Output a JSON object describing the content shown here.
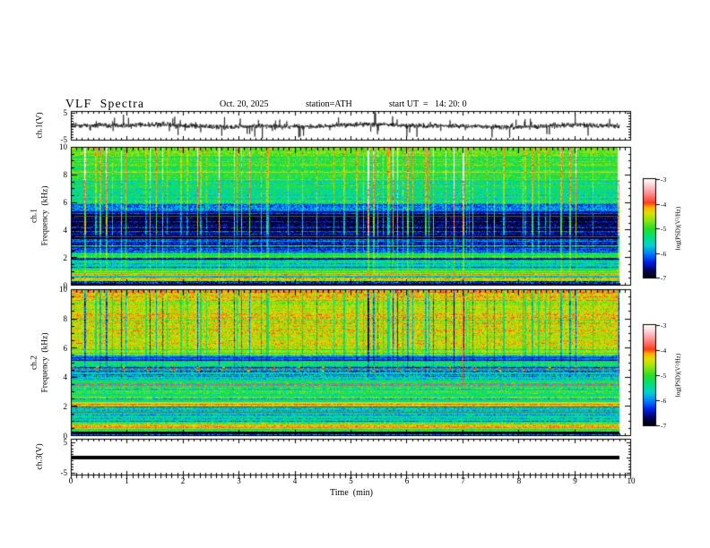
{
  "title": {
    "main": "VLF  Spectra",
    "date": "Oct. 20, 2025",
    "station": "station=ATH",
    "start_ut": "start UT  =   14: 20: 0"
  },
  "xaxis": {
    "label": "Time  (min)",
    "ticks": [
      "0",
      "1",
      "2",
      "3",
      "4",
      "5",
      "6",
      "7",
      "8",
      "9",
      "10"
    ]
  },
  "panels": {
    "ch1_voltage": {
      "ylabel": "ch.1(V)",
      "yticks": [
        "5",
        "-5"
      ]
    },
    "ch1_spectrogram": {
      "channel": "ch.1",
      "ylabel": "Frequency  (kHz)",
      "yticks": [
        "10",
        "8",
        "6",
        "4",
        "2",
        "0"
      ]
    },
    "ch2_spectrogram": {
      "channel": "ch.2",
      "ylabel": "Frequency  (kHz)",
      "yticks": [
        "10",
        "8",
        "6",
        "4",
        "2",
        "0"
      ]
    },
    "ch3_voltage": {
      "ylabel": "ch.3(V)",
      "yticks": [
        "5",
        "-5"
      ]
    }
  },
  "colorbars": [
    {
      "label": "log(PSD)(V²/Hz)",
      "ticks": [
        "-3",
        "-4",
        "-5",
        "-6",
        "-7"
      ]
    },
    {
      "label": "log(PSD)(V²/Hz)",
      "ticks": [
        "-3",
        "-4",
        "-5",
        "-6",
        "-7"
      ]
    }
  ],
  "chart_data": {
    "type": "multi-panel: line waveform + 2 spectrograms (heatmap) + line",
    "title": "VLF Spectra",
    "date": "Oct. 20, 2025",
    "station": "ATH",
    "start_ut": "14:20:0",
    "x": {
      "label": "Time (min)",
      "range": [
        0,
        10
      ],
      "data_extent": [
        0,
        9.8
      ],
      "major_tick": 1,
      "minor_tick": 0.1
    },
    "colorbar": {
      "label": "log(PSD)(V²/Hz)",
      "range": [
        -7,
        -3
      ],
      "ticks": [
        -3,
        -4,
        -5,
        -6,
        -7
      ],
      "orientation": "vertical",
      "position": "right"
    },
    "colormap_stops": [
      [
        0.0,
        0,
        0,
        0
      ],
      [
        0.07,
        5,
        0,
        80
      ],
      [
        0.16,
        0,
        30,
        230
      ],
      [
        0.25,
        0,
        130,
        255
      ],
      [
        0.33,
        0,
        210,
        210
      ],
      [
        0.42,
        0,
        225,
        120
      ],
      [
        0.5,
        40,
        220,
        40
      ],
      [
        0.58,
        140,
        230,
        20
      ],
      [
        0.66,
        225,
        225,
        0
      ],
      [
        0.72,
        255,
        170,
        0
      ],
      [
        0.76,
        255,
        60,
        25
      ],
      [
        0.83,
        255,
        120,
        115
      ],
      [
        0.91,
        255,
        185,
        190
      ],
      [
        1.0,
        255,
        255,
        255
      ]
    ],
    "panels": [
      {
        "id": "ch1_waveform",
        "kind": "line",
        "ylabel": "ch.1(V)",
        "yrange_v": [
          -5,
          5
        ],
        "line_color": "#000000",
        "character": "continuous broadband noise around 0 V (~±1 V) with frequent impulsive sferic spikes reaching ±5 V"
      },
      {
        "id": "ch1_spectrogram",
        "kind": "spectrogram",
        "channel": "ch.1",
        "freq_range_khz": [
          0,
          10
        ],
        "psd_log_range": [
          -7,
          -3
        ],
        "bands": [
          [
            9.3,
            10.01,
            -4.55,
            0.06,
            0.18,
            0.5,
            "hot"
          ],
          [
            7.6,
            9.3,
            -4.75,
            0.06,
            0.18,
            0.46,
            "hot"
          ],
          [
            6.0,
            7.6,
            -5.0,
            0.07,
            0.22,
            0.52,
            ""
          ],
          [
            5.45,
            6.0,
            -5.6,
            0.08,
            0.22,
            0.58,
            ""
          ],
          [
            5.15,
            5.45,
            -6.2,
            0.08,
            0.15,
            0.35,
            ""
          ],
          [
            3.65,
            5.15,
            -6.25,
            0.1,
            0.22,
            0.8,
            ""
          ],
          [
            3.35,
            3.65,
            -6.65,
            0.1,
            0.15,
            0.3,
            ""
          ],
          [
            2.3,
            3.35,
            -5.95,
            0.14,
            0.2,
            0.35,
            ""
          ],
          [
            2.0,
            2.3,
            -4.85,
            0.08,
            0.15,
            0.18,
            ""
          ],
          [
            1.15,
            2.0,
            -5.65,
            0.14,
            0.22,
            0.2,
            ""
          ],
          [
            0.8,
            1.15,
            -4.5,
            0.16,
            0.15,
            0.1,
            ""
          ],
          [
            0.35,
            0.8,
            -5.0,
            0.2,
            0.22,
            0.1,
            ""
          ],
          [
            0.0,
            0.35,
            -6.5,
            0.22,
            0.28,
            0.06,
            ""
          ]
        ],
        "gray_harmonic_lines_khz": [
          5.05,
          3.52
        ],
        "streaks": "bright vertical sferic streaks, orange/red bursts above 7.5 kHz, dark blue background 3.6-5.2 kHz"
      },
      {
        "id": "ch2_spectrogram",
        "kind": "spectrogram",
        "channel": "ch.2",
        "freq_range_khz": [
          0,
          10
        ],
        "psd_log_range": [
          -7,
          -3
        ],
        "bands": [
          [
            9.4,
            10.01,
            -4.5,
            0.06,
            0.2,
            -0.52,
            "specks"
          ],
          [
            6.0,
            9.4,
            -4.8,
            0.06,
            0.2,
            -0.58,
            ""
          ],
          [
            5.5,
            6.0,
            -5.15,
            0.08,
            0.2,
            -0.4,
            ""
          ],
          [
            5.15,
            5.5,
            -6.35,
            0.08,
            0.15,
            -0.15,
            ""
          ],
          [
            4.75,
            5.15,
            -5.3,
            0.1,
            0.22,
            -0.2,
            ""
          ],
          [
            4.4,
            4.75,
            -6.0,
            0.12,
            0.25,
            -0.1,
            "dash2"
          ],
          [
            3.95,
            4.4,
            -5.75,
            0.1,
            0.25,
            -0.1,
            ""
          ],
          [
            3.6,
            3.95,
            -5.35,
            0.1,
            0.22,
            0,
            ""
          ],
          [
            3.42,
            3.6,
            -5.2,
            0.08,
            0.18,
            0,
            "dash"
          ],
          [
            2.6,
            3.42,
            -5.15,
            0.12,
            0.22,
            0,
            ""
          ],
          [
            2.3,
            2.6,
            -5.5,
            0.12,
            0.2,
            0,
            ""
          ],
          [
            2.02,
            2.3,
            -4.3,
            0.08,
            0.12,
            0,
            ""
          ],
          [
            1.93,
            2.02,
            -6.1,
            0.06,
            0.1,
            0,
            ""
          ],
          [
            1.0,
            1.93,
            -5.5,
            0.14,
            0.22,
            0,
            ""
          ],
          [
            0.78,
            1.0,
            -5.05,
            0.12,
            0.2,
            0,
            ""
          ],
          [
            0.55,
            0.78,
            -4.15,
            0.1,
            0.15,
            0,
            ""
          ],
          [
            0.28,
            0.55,
            -4.95,
            0.14,
            0.2,
            0,
            ""
          ],
          [
            0.0,
            0.28,
            -6.45,
            0.2,
            0.3,
            0,
            ""
          ]
        ],
        "gray_harmonic_lines_khz": [
          4.6,
          1.62
        ],
        "red_dash_lines_khz": [
          3.5
        ],
        "streaks": "dark blue vertical streaks above 6 kHz (inverse of ch.1), occasional red vertical transients"
      },
      {
        "id": "ch3_waveform",
        "kind": "line",
        "ylabel": "ch.3(V)",
        "yrange_v": [
          -5,
          5
        ],
        "line_color": "#000000",
        "character": "flat thick saturated line at 0 V spanning 0 to 9.8 min"
      }
    ]
  }
}
